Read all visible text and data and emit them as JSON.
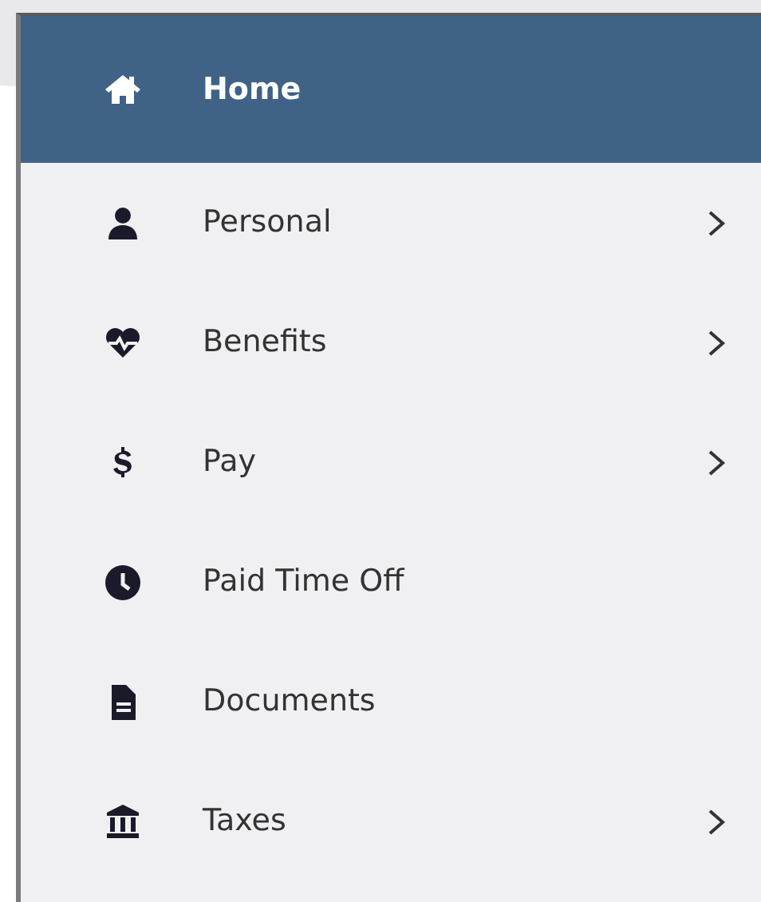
{
  "menu": {
    "items": [
      {
        "label": "Home",
        "selected": true,
        "has_submenu": false
      },
      {
        "label": "Personal",
        "selected": false,
        "has_submenu": true
      },
      {
        "label": "Benefits",
        "selected": false,
        "has_submenu": true
      },
      {
        "label": "Pay",
        "selected": false,
        "has_submenu": true
      },
      {
        "label": "Paid Time Off",
        "selected": false,
        "has_submenu": false
      },
      {
        "label": "Documents",
        "selected": false,
        "has_submenu": false
      },
      {
        "label": "Taxes",
        "selected": false,
        "has_submenu": true
      }
    ]
  }
}
